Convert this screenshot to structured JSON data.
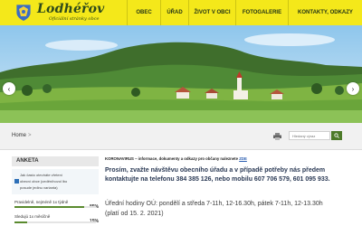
{
  "header": {
    "site_title": "Lodhéřov",
    "site_subtitle": "Oficiální stránky obce",
    "nav": [
      "OBEC",
      "ÚŘAD",
      "ŽIVOT V OBCI",
      "FOTOGALERIE",
      "KONTAKTY, ODKAZY"
    ],
    "bg_color": "#f4e81a"
  },
  "hero": {
    "prev_label": "‹",
    "next_label": "›"
  },
  "breadcrumb": {
    "home": "Home",
    "separator": ">"
  },
  "search": {
    "placeholder": "Hledaný výraz"
  },
  "icons": [
    "print-icon",
    "search-icon",
    "crest-icon",
    "checkbox-icon"
  ],
  "anketa": {
    "title": "ANKETA",
    "question_lines": [
      "Jak často otevíráte vřetení",
      "obecní obce (ceděníhovol lbo",
      "posude jedinu varianta)"
    ],
    "options": [
      {
        "label": "Pravidelně, nejméně 1x týdně",
        "percent": "85%",
        "value": 0.85
      },
      {
        "label": "Sledujú 1x měsíčně",
        "percent": "15%",
        "value": 0.15
      }
    ]
  },
  "notice": {
    "strip_text": "KORONAVIRUS – informace, dokumenty a odkazy pro občany naleznete",
    "strip_link": "ZDE",
    "bold_text": "Prosím, zvažte návštěvu obecního úřadu a v případě potřeby nás předem kontaktujte na telefonu 384 385 126, nebo mobilu 607 706 579, 601 095 933.",
    "hours_line1": "Úřední hodiny OÚ: pondělí a středa 7-11h, 12-16.30h, pátek 7-11h, 12-13.30h",
    "hours_line2": "(platí od 15. 2. 2021)"
  }
}
